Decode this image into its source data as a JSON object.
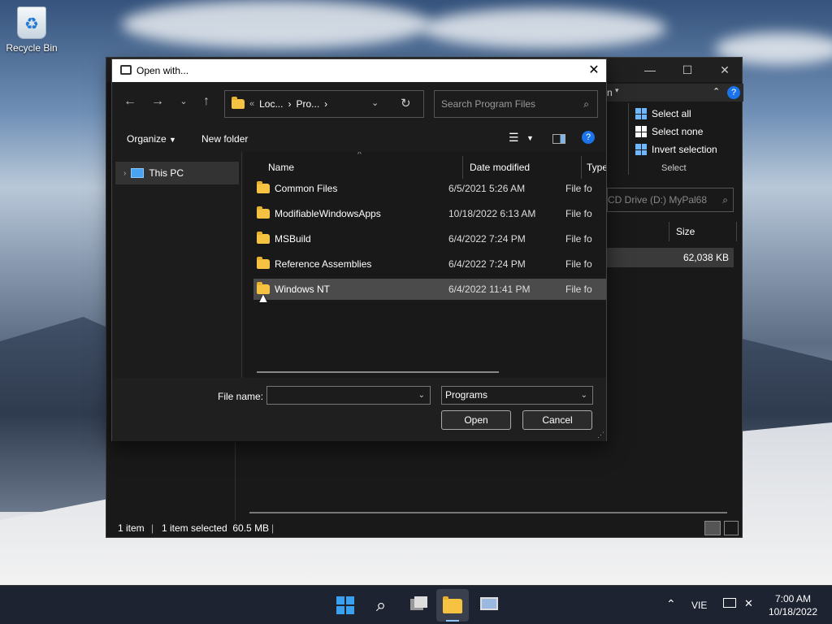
{
  "desktop": {
    "recycle_bin": "Recycle Bin"
  },
  "explorer": {
    "ribbon": {
      "partial_label": "n",
      "select_all": "Select all",
      "select_none": "Select none",
      "invert_selection": "Invert selection",
      "group_label": "Select"
    },
    "search_placeholder": "CD Drive (D:) MyPal68",
    "col_size": "Size",
    "file_size": "62,038 KB",
    "status": {
      "count": "1 item",
      "selected": "1 item selected  60.5 MB"
    }
  },
  "dialog": {
    "title": "Open with...",
    "address": {
      "seg1_prefix": "«",
      "seg1": "Loc...",
      "seg2": "Pro..."
    },
    "search_placeholder": "Search Program Files",
    "toolbar": {
      "organize": "Organize",
      "new_folder": "New folder"
    },
    "nav": {
      "this_pc": "This PC"
    },
    "columns": {
      "name": "Name",
      "date": "Date modified",
      "type": "Type"
    },
    "files": [
      {
        "name": "Common Files",
        "date": "6/5/2021 5:26 AM",
        "type": "File fo"
      },
      {
        "name": "ModifiableWindowsApps",
        "date": "10/18/2022 6:13 AM",
        "type": "File fo"
      },
      {
        "name": "MSBuild",
        "date": "6/4/2022 7:24 PM",
        "type": "File fo"
      },
      {
        "name": "Reference Assemblies",
        "date": "6/4/2022 7:24 PM",
        "type": "File fo"
      },
      {
        "name": "Windows NT",
        "date": "6/4/2022 11:41 PM",
        "type": "File fo"
      }
    ],
    "file_name_label": "File name:",
    "file_name_value": "",
    "filter": "Programs",
    "open": "Open",
    "cancel": "Cancel"
  },
  "taskbar": {
    "lang": "VIE",
    "time": "7:00 AM",
    "date": "10/18/2022"
  }
}
